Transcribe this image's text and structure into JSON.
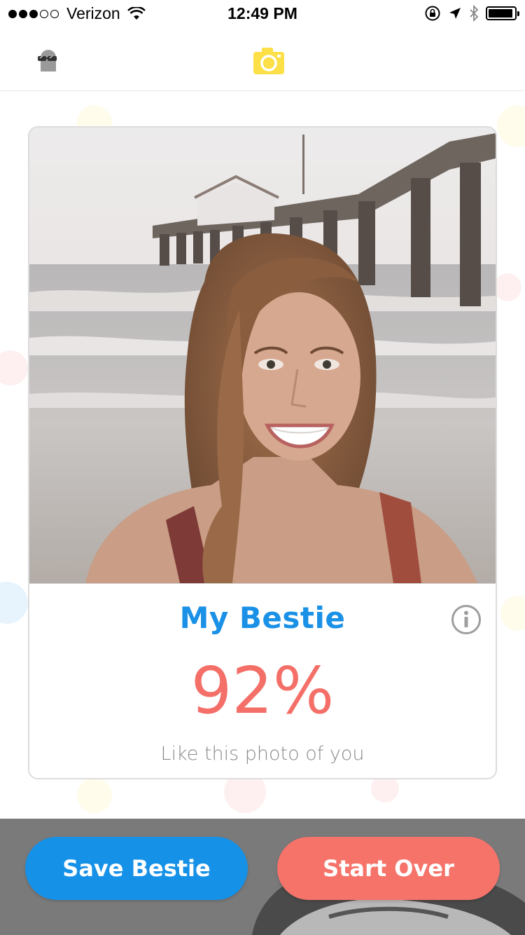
{
  "status_bar": {
    "carrier": "Verizon",
    "time": "12:49 PM",
    "signal_bars_filled": 3,
    "signal_bars_total": 5,
    "battery_level": 0.95
  },
  "nav": {
    "left_icon": "sunglasses-face-icon",
    "center_icon": "camera-icon"
  },
  "card": {
    "title": "My Bestie",
    "score": "92%",
    "subtitle": "Like this photo of you",
    "info_icon": "info-icon"
  },
  "footer": {
    "save_label": "Save Bestie",
    "start_over_label": "Start Over"
  },
  "colors": {
    "accent_blue": "#1691e8",
    "accent_coral": "#f6736a",
    "camera_yellow": "#fde047"
  }
}
